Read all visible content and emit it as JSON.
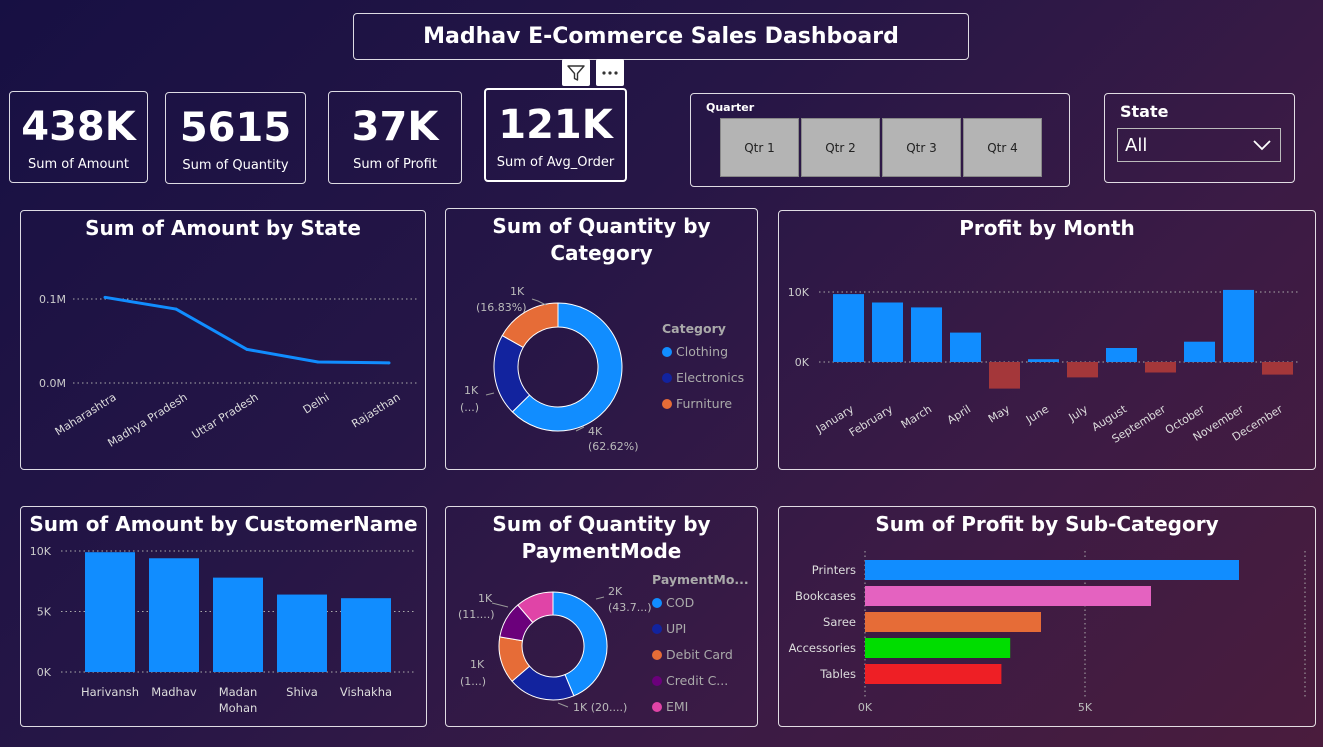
{
  "header": {
    "title": "Madhav E-Commerce Sales Dashboard"
  },
  "kpis": [
    {
      "value": "438K",
      "label": "Sum of Amount"
    },
    {
      "value": "5615",
      "label": "Sum of Quantity"
    },
    {
      "value": "37K",
      "label": "Sum of Profit"
    },
    {
      "value": "121K",
      "label": "Sum of Avg_Order"
    }
  ],
  "quarter_slicer": {
    "title": "Quarter",
    "options": [
      "Qtr 1",
      "Qtr 2",
      "Qtr 3",
      "Qtr 4"
    ]
  },
  "state_slicer": {
    "title": "State",
    "selected": "All"
  },
  "colors": {
    "primary": "#118dff",
    "negative": "#a4373a",
    "navy": "#12239e",
    "orange": "#e66c37",
    "purple": "#6b007b",
    "pink": "#e044a7",
    "magenta": "#e462c0",
    "green": "#00dd00",
    "red": "#ee1f25"
  },
  "chart_data": [
    {
      "id": "amount_by_state",
      "type": "line",
      "title": "Sum of Amount by State",
      "categories": [
        "Maharashtra",
        "Madhya Pradesh",
        "Uttar Pradesh",
        "Delhi",
        "Rajasthan"
      ],
      "values": [
        0.102,
        0.088,
        0.04,
        0.025,
        0.024
      ],
      "yticks": [
        "0.1M",
        "0.0M"
      ],
      "ylim": [
        0,
        0.1
      ]
    },
    {
      "id": "quantity_by_category",
      "type": "pie",
      "title": "Sum of Quantity by Category",
      "legend_title": "Category",
      "categories": [
        "Clothing",
        "Electronics",
        "Furniture"
      ],
      "values": [
        62.62,
        20.55,
        16.83
      ],
      "labels": [
        [
          "4K",
          "(62.62%)"
        ],
        [
          "1K",
          "(...)"
        ],
        [
          "1K",
          "(16.83%)"
        ]
      ]
    },
    {
      "id": "profit_by_month",
      "type": "bar",
      "title": "Profit by Month",
      "categories": [
        "January",
        "February",
        "March",
        "April",
        "May",
        "June",
        "July",
        "August",
        "September",
        "October",
        "November",
        "December"
      ],
      "values": [
        9700,
        8500,
        7800,
        4200,
        -3800,
        400,
        -2200,
        2000,
        -1500,
        2900,
        10300,
        -1800
      ],
      "yticks": [
        "10K",
        "0K"
      ],
      "ylim": [
        -5000,
        10000
      ]
    },
    {
      "id": "amount_by_customer",
      "type": "bar",
      "title": "Sum of Amount by CustomerName",
      "categories": [
        "Harivansh",
        "Madhav",
        "Madan Mohan",
        "Shiva",
        "Vishakha"
      ],
      "values": [
        9900,
        9400,
        7800,
        6400,
        6100
      ],
      "yticks": [
        "10K",
        "5K",
        "0K"
      ],
      "ylim": [
        0,
        10000
      ]
    },
    {
      "id": "quantity_by_paymentmode",
      "type": "pie",
      "title": "Sum of Quantity by PaymentMode",
      "legend_title": "PaymentMo...",
      "categories": [
        "COD",
        "UPI",
        "Debit Card",
        "Credit C...",
        "EMI"
      ],
      "values": [
        43.7,
        20.0,
        14.0,
        11.0,
        11.3
      ],
      "labels": [
        [
          "2K",
          "(43.7...)"
        ],
        [
          "1K (20....)"
        ],
        [
          "1K",
          "(1...)"
        ],
        [
          "1K",
          "(11....)"
        ],
        [
          "",
          ""
        ]
      ]
    },
    {
      "id": "profit_by_subcategory",
      "type": "bar",
      "title": "Sum of Profit by Sub-Category",
      "categories": [
        "Printers",
        "Bookcases",
        "Saree",
        "Accessories",
        "Tables"
      ],
      "values": [
        8500,
        6500,
        4000,
        3300,
        3100
      ],
      "xticks": [
        "0K",
        "5K"
      ],
      "xlim": [
        0,
        10000
      ]
    }
  ]
}
